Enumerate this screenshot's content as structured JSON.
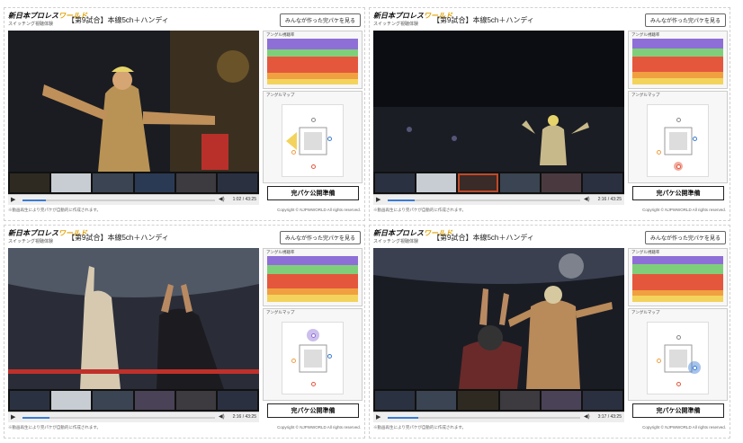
{
  "common": {
    "logo_main": "新日本プロレス",
    "logo_accent": "ワールド",
    "logo_sub": "スイッチング視聴体験",
    "match_title": "【第9試合】本線5ch＋ハンディ",
    "share_button": "みんなが作った完パケを見る",
    "rate_title": "アングル視聴率",
    "map_title": "アングルマップ",
    "publish_button": "完パケ公開準備",
    "note": "※動画再生により完パケが自動的に作成されます。",
    "copyright": "Copyright © NJPWWORLD All rights reserved."
  },
  "panels": [
    {
      "time": "1:02 / 43:25",
      "progress": 0.12
    },
    {
      "time": "2:16 / 43:25",
      "progress": 0.14
    },
    {
      "time": "2:16 / 43:25",
      "progress": 0.14
    },
    {
      "time": "3:17 / 43:25",
      "progress": 0.16
    }
  ],
  "colors": {
    "band_purple": "#8e6fd8",
    "band_green": "#7fcf7a",
    "band_red": "#e4573d",
    "band_orange": "#f0a040",
    "band_yellow": "#f3d35c",
    "accent_blue": "#3a7bd5"
  }
}
